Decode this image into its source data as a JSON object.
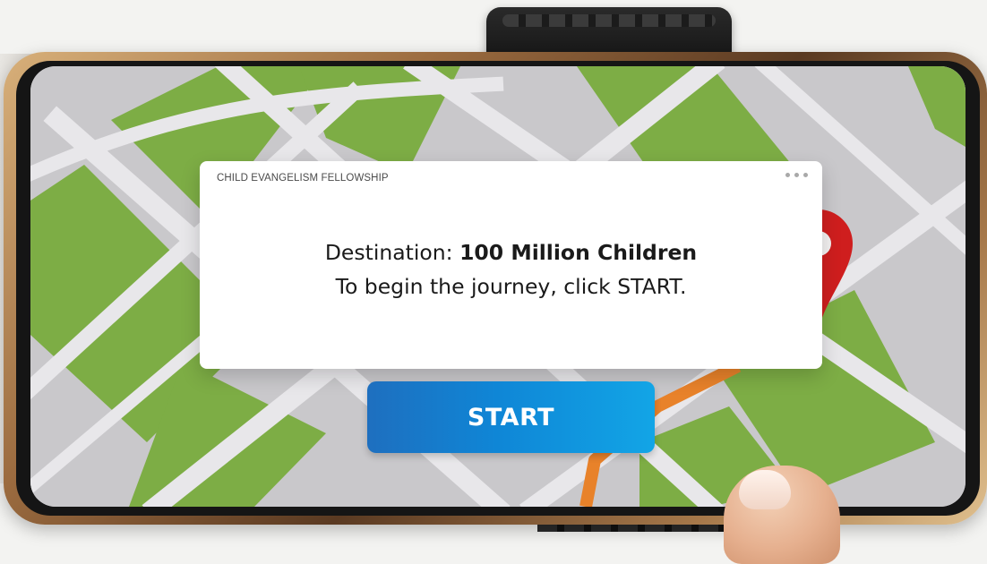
{
  "card": {
    "org_name": "CHILD EVANGELISM FELLOWSHIP",
    "line1_prefix": "Destination: ",
    "line1_bold": "100 Million Children",
    "line2": "To begin the journey, click START."
  },
  "start_button": {
    "label": "START"
  },
  "colors": {
    "map_grass": "#7dad45",
    "map_road": "#e8e7ea",
    "map_block": "#c9c8cb",
    "route_orange": "#e8822a",
    "pin_red": "#cf1e1e",
    "button_blue": "#0f86d6"
  },
  "icons": {
    "menu": "more-dots-icon",
    "pin": "location-pin-icon"
  }
}
